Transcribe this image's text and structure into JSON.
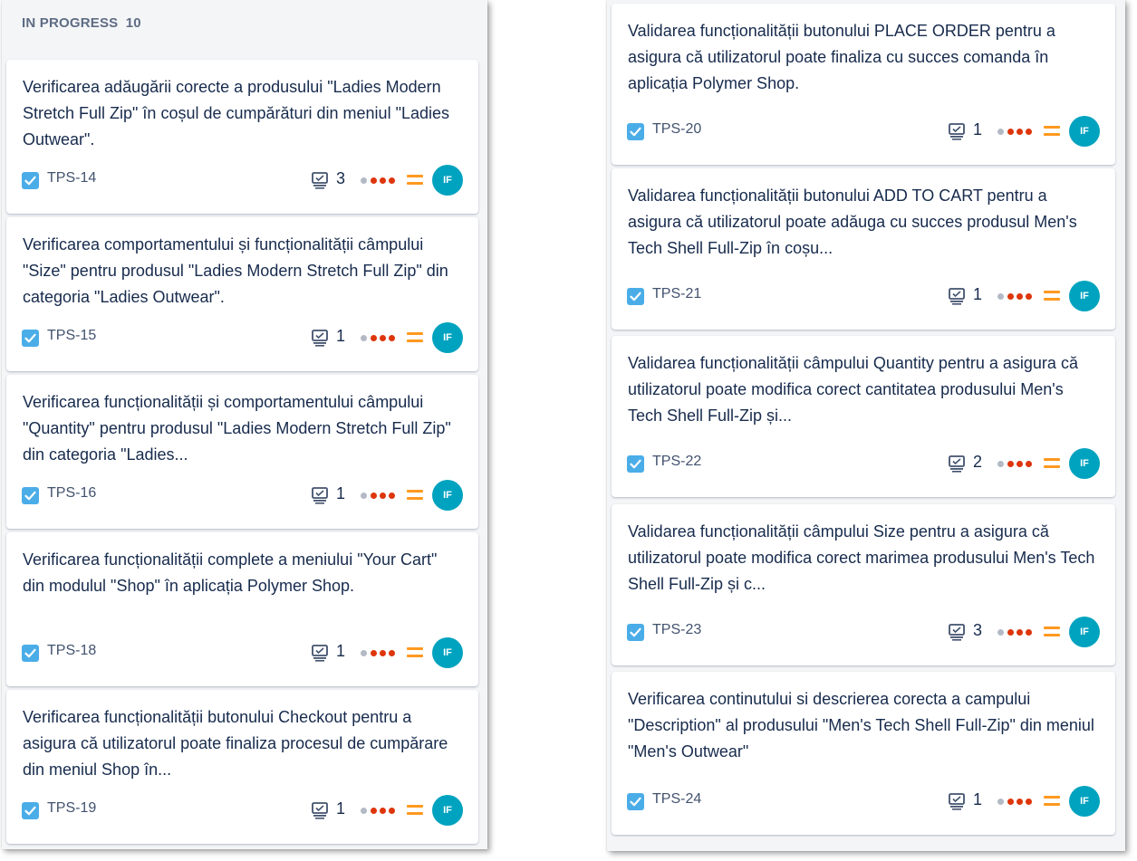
{
  "colors": {
    "dot_gray": "#b3bac5",
    "dot_red": "#de350b",
    "priority": "#ff991f",
    "avatar_bg": "#00a3bf",
    "type_icon": "#4bade8"
  },
  "left_column": {
    "header_title": "IN PROGRESS",
    "header_count": "10",
    "cards": [
      {
        "title": "Verificarea adăugării corecte a produsului \"Ladies Modern Stretch Full Zip\" în coșul de cumpărături din meniul \"Ladies Outwear\".",
        "key": "TPS-14",
        "subtasks": "3",
        "avatar": "IF",
        "type_icon": "checkbox-icon",
        "priority_icon": "medium-priority-icon"
      },
      {
        "title": "Verificarea comportamentului și funcționalității câmpului \"Size\" pentru produsul \"Ladies Modern Stretch Full Zip\" din categoria \"Ladies Outwear\".",
        "key": "TPS-15",
        "subtasks": "1",
        "avatar": "IF",
        "type_icon": "checkbox-icon",
        "priority_icon": "medium-priority-icon"
      },
      {
        "title": "Verificarea funcționalității și comportamentului câmpului \"Quantity\" pentru produsul \"Ladies Modern Stretch Full Zip\" din categoria \"Ladies...",
        "key": "TPS-16",
        "subtasks": "1",
        "avatar": "IF",
        "type_icon": "checkbox-icon",
        "priority_icon": "medium-priority-icon"
      },
      {
        "title": "Verificarea funcționalității complete a meniului \"Your Cart\" din modulul \"Shop\" în aplicația Polymer Shop.",
        "key": "TPS-18",
        "subtasks": "1",
        "avatar": "IF",
        "type_icon": "checkbox-icon",
        "priority_icon": "medium-priority-icon"
      },
      {
        "title": "Verificarea funcționalității butonului Checkout pentru a asigura că utilizatorul poate finaliza procesul de cumpărare din meniul Shop în...",
        "key": "TPS-19",
        "subtasks": "1",
        "avatar": "IF",
        "type_icon": "checkbox-icon",
        "priority_icon": "medium-priority-icon"
      }
    ]
  },
  "right_column": {
    "cards": [
      {
        "title": "Validarea funcționalității butonului PLACE ORDER pentru a asigura că utilizatorul poate finaliza cu succes comanda în aplicația Polymer Shop.",
        "key": "TPS-20",
        "subtasks": "1",
        "avatar": "IF",
        "type_icon": "checkbox-icon",
        "priority_icon": "medium-priority-icon"
      },
      {
        "title": "Validarea funcționalității butonului ADD TO CART pentru a asigura că utilizatorul poate adăuga cu succes produsul Men's Tech Shell Full-Zip în coșu...",
        "key": "TPS-21",
        "subtasks": "1",
        "avatar": "IF",
        "type_icon": "checkbox-icon",
        "priority_icon": "medium-priority-icon"
      },
      {
        "title": "Validarea funcționalității câmpului Quantity pentru a asigura că utilizatorul poate modifica corect cantitatea produsului Men's Tech Shell Full-Zip și...",
        "key": "TPS-22",
        "subtasks": "2",
        "avatar": "IF",
        "type_icon": "checkbox-icon",
        "priority_icon": "medium-priority-icon"
      },
      {
        "title": "Validarea funcționalității câmpului Size pentru a asigura că utilizatorul poate modifica corect marimea produsului Men's Tech Shell Full-Zip și c...",
        "key": "TPS-23",
        "subtasks": "3",
        "avatar": "IF",
        "type_icon": "checkbox-icon",
        "priority_icon": "medium-priority-icon"
      },
      {
        "title": "Verificarea continutului si descrierea corecta a campului \"Description\" al produsului \"Men's Tech Shell Full-Zip\" din meniul \"Men's Outwear\"",
        "key": "TPS-24",
        "subtasks": "1",
        "avatar": "IF",
        "type_icon": "checkbox-icon",
        "priority_icon": "medium-priority-icon"
      }
    ]
  }
}
